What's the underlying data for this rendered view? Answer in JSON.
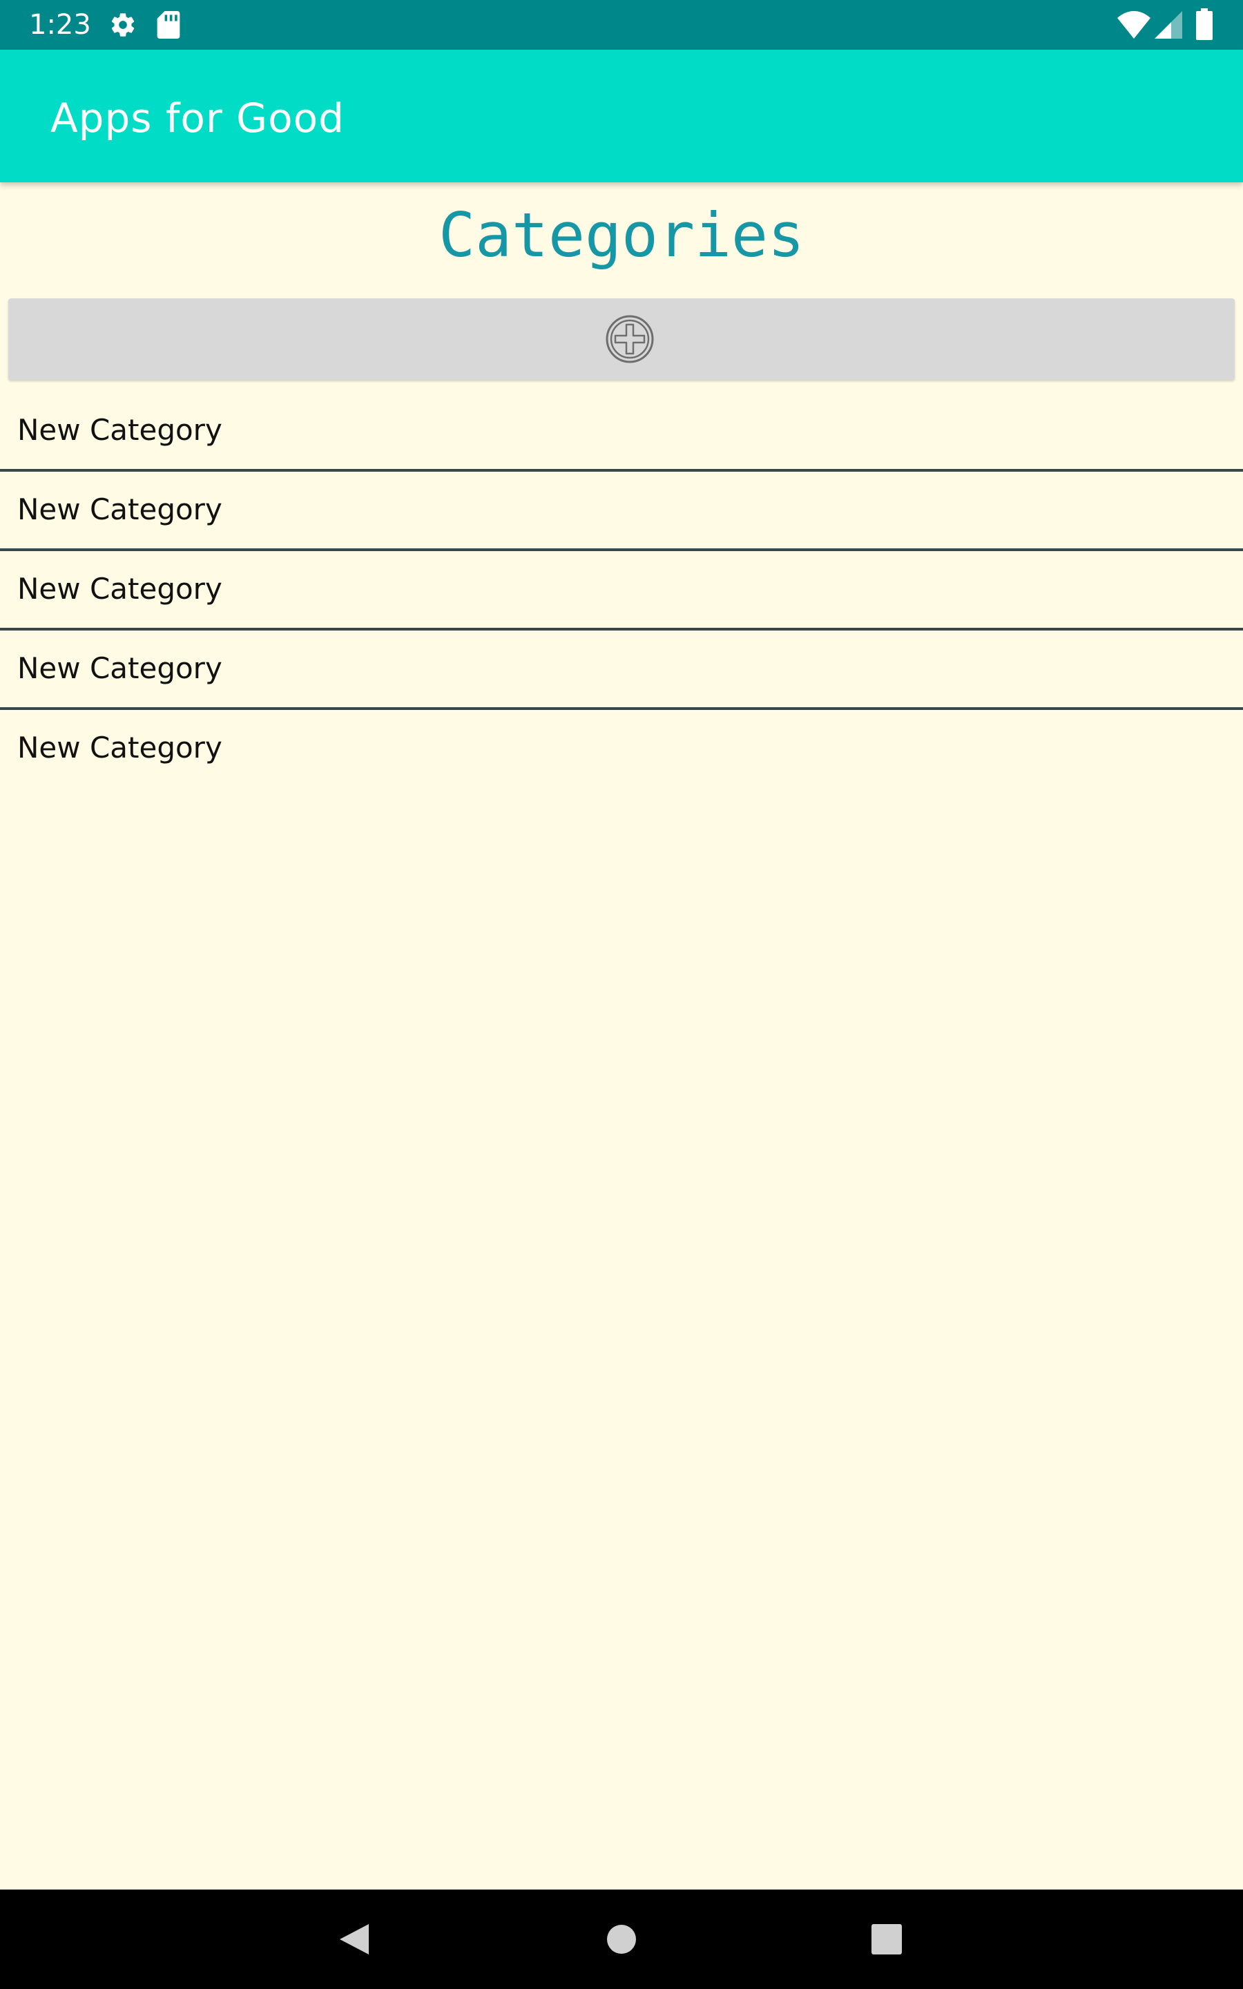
{
  "status_bar": {
    "time": "1:23",
    "icons": [
      "settings-gear-icon",
      "sd-card-icon",
      "wifi-icon",
      "cellular-signal-icon",
      "battery-icon"
    ]
  },
  "app_bar": {
    "title": "Apps for Good"
  },
  "page": {
    "title": "Categories",
    "add_button_icon": "add-circle-icon"
  },
  "categories": [
    {
      "label": "New Category"
    },
    {
      "label": "New Category"
    },
    {
      "label": "New Category"
    },
    {
      "label": "New Category"
    },
    {
      "label": "New Category"
    }
  ],
  "nav_bar": {
    "buttons": [
      "back-icon",
      "home-icon",
      "recents-icon"
    ]
  },
  "colors": {
    "status_bar": "#00878A",
    "app_bar": "#00DCC5",
    "background": "#FFFBE4",
    "title": "#1597A5",
    "add_button": "#D8D8D8",
    "divider": "#37474C"
  }
}
